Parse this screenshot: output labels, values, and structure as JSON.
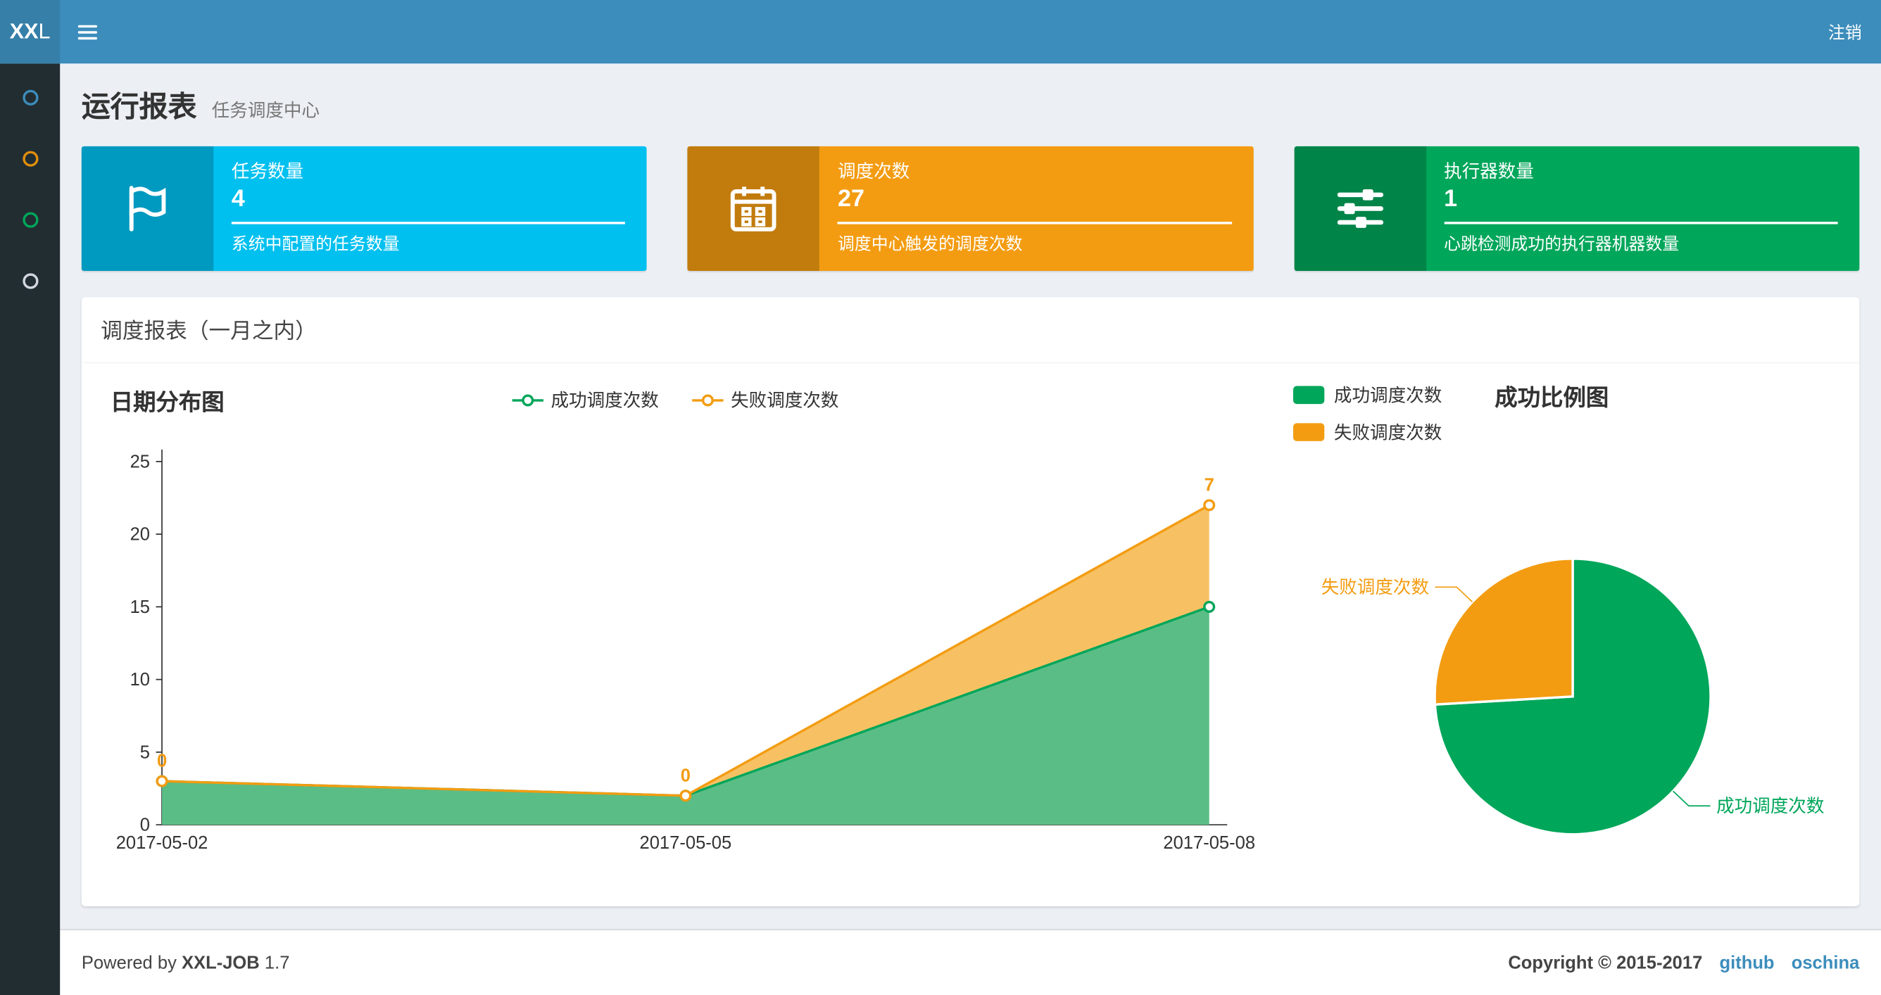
{
  "navbar": {
    "logo_bold": "XX",
    "logo_rest": "L",
    "logout_label": "注销",
    "bg_color": "#3c8dbc",
    "logo_bg_color": "#367fa9"
  },
  "sidebar": {
    "bg_color": "#222d32",
    "items": [
      {
        "icon": "circle-icon",
        "color": "#3c8dbc"
      },
      {
        "icon": "circle-icon",
        "color": "#e08e0b"
      },
      {
        "icon": "circle-icon",
        "color": "#00a65a"
      },
      {
        "icon": "circle-icon",
        "color": "#d2d6de"
      }
    ]
  },
  "page": {
    "title": "运行报表",
    "subtitle": "任务调度中心"
  },
  "info_boxes": [
    {
      "label": "任务数量",
      "value": "4",
      "description": "系统中配置的任务数量",
      "color": "#00c0ef",
      "icon": "flag-icon"
    },
    {
      "label": "调度次数",
      "value": "27",
      "description": "调度中心触发的调度次数",
      "color": "#f39c12",
      "icon": "calendar-icon"
    },
    {
      "label": "执行器数量",
      "value": "1",
      "description": "心跳检测成功的执行器机器数量",
      "color": "#00a65a",
      "icon": "sliders-icon"
    }
  ],
  "panel": {
    "title": "调度报表（一月之内）"
  },
  "chart_data": [
    {
      "type": "area",
      "title": "日期分布图",
      "stacked": true,
      "x": [
        "2017-05-02",
        "2017-05-05",
        "2017-05-08"
      ],
      "ylim": [
        0,
        25
      ],
      "yticks": [
        0,
        5,
        10,
        15,
        20,
        25
      ],
      "grid": false,
      "legend_position": "top-center",
      "series": [
        {
          "name": "成功调度次数",
          "values": [
            3,
            2,
            15
          ],
          "color": "#00a65a",
          "fill": "#5bbd86"
        },
        {
          "name": "失败调度次数",
          "values": [
            0,
            0,
            7
          ],
          "color": "#f39c12",
          "fill": "#f7c163",
          "point_labels": [
            "0",
            "0",
            "7"
          ]
        }
      ]
    },
    {
      "type": "pie",
      "title": "成功比例图",
      "legend_position": "top-left",
      "slices": [
        {
          "name": "成功调度次数",
          "value": 20,
          "color": "#00a65a"
        },
        {
          "name": "失败调度次数",
          "value": 7,
          "color": "#f39c12"
        }
      ]
    }
  ],
  "footer": {
    "powered_prefix": "Powered by",
    "app_name": "XXL-JOB",
    "version": "1.7",
    "copyright": "Copyright © 2015-2017",
    "links": [
      {
        "label": "github"
      },
      {
        "label": "oschina"
      }
    ]
  }
}
